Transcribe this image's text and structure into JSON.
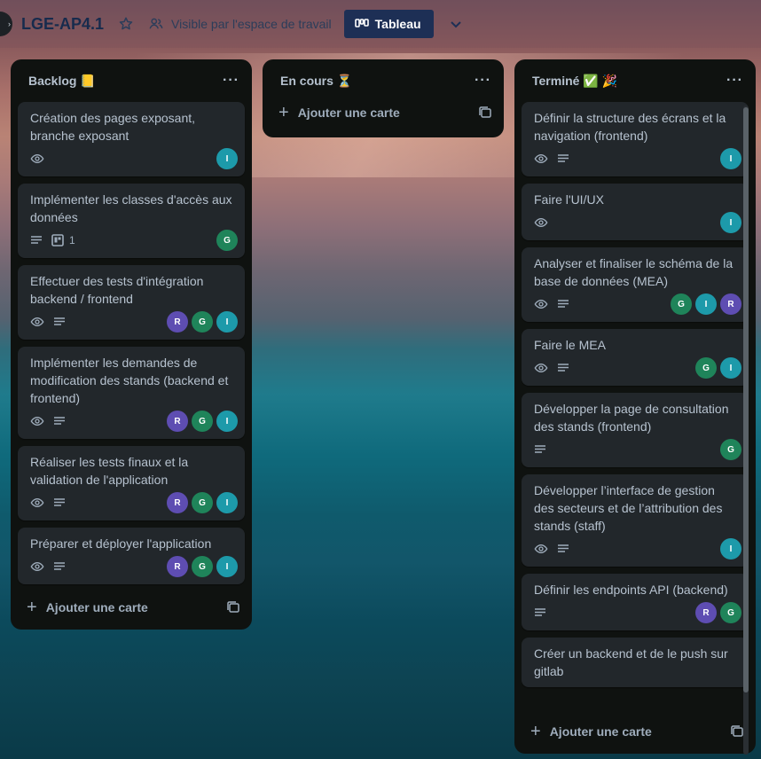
{
  "header": {
    "board_title": "LGE-AP4.1",
    "visibility": "Visible par l'espace de travail",
    "view_label": "Tableau"
  },
  "lists": [
    {
      "title": "Backlog 📒",
      "add_card": "Ajouter une carte",
      "cards": [
        {
          "title": "Création des pages exposant, branche exposant",
          "watch": true,
          "desc": false,
          "checklist": "",
          "members": [
            "I"
          ]
        },
        {
          "title": "Implémenter les classes d'accès aux données",
          "watch": false,
          "desc": true,
          "checklist": "1",
          "members": [
            "G"
          ]
        },
        {
          "title": "Effectuer des tests d'intégration backend / frontend",
          "watch": true,
          "desc": true,
          "checklist": "",
          "members": [
            "R",
            "G",
            "I"
          ]
        },
        {
          "title": "Implémenter les demandes de modification des stands (backend et frontend)",
          "watch": true,
          "desc": true,
          "checklist": "",
          "members": [
            "R",
            "G",
            "I"
          ]
        },
        {
          "title": "Réaliser les tests finaux et la validation de l'application",
          "watch": true,
          "desc": true,
          "checklist": "",
          "members": [
            "R",
            "G",
            "I"
          ]
        },
        {
          "title": "Préparer et déployer l'application",
          "watch": true,
          "desc": true,
          "checklist": "",
          "members": [
            "R",
            "G",
            "I"
          ]
        }
      ]
    },
    {
      "title": "En cours ⏳",
      "add_card": "Ajouter une carte",
      "cards": []
    },
    {
      "title": "Terminé ✅ 🎉",
      "add_card": "Ajouter une carte",
      "cards": [
        {
          "title": "Définir la structure des écrans et la navigation (frontend)",
          "watch": true,
          "desc": true,
          "checklist": "",
          "members": [
            "I"
          ]
        },
        {
          "title": "Faire l'UI/UX",
          "watch": true,
          "desc": false,
          "checklist": "",
          "members": [
            "I"
          ]
        },
        {
          "title": "Analyser et finaliser le schéma de la base de données (MEA)",
          "watch": true,
          "desc": true,
          "checklist": "",
          "members": [
            "G",
            "I",
            "R"
          ]
        },
        {
          "title": "Faire le MEA",
          "watch": true,
          "desc": true,
          "checklist": "",
          "members": [
            "G",
            "I"
          ]
        },
        {
          "title": "Développer la page de consultation des stands (frontend)",
          "watch": false,
          "desc": true,
          "checklist": "",
          "members": [
            "G"
          ]
        },
        {
          "title": "Développer l’interface de gestion des secteurs et de l’attribution des stands (staff)",
          "watch": true,
          "desc": true,
          "checklist": "",
          "members": [
            "I"
          ]
        },
        {
          "title": "Définir les endpoints API (backend)",
          "watch": false,
          "desc": true,
          "checklist": "",
          "members": [
            "R",
            "G"
          ]
        },
        {
          "title": "Créer un backend et de le push sur gitlab",
          "watch": false,
          "desc": false,
          "checklist": "",
          "members": []
        }
      ]
    }
  ],
  "colors": {
    "member_R": "#5e4db2",
    "member_G": "#1f845a",
    "member_I": "#1d9aaa",
    "list_bg": "#0f1210",
    "card_bg": "#22272b"
  }
}
